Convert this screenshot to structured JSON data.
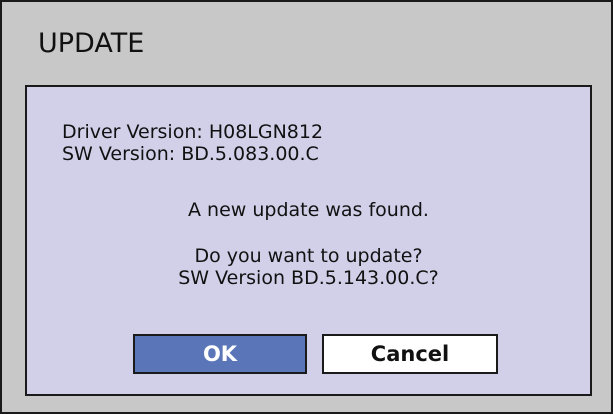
{
  "dialog": {
    "title": "UPDATE",
    "driver_version": "Driver Version:  H08LGN812",
    "sw_version": "SW Version:  BD.5.083.00.C",
    "message_found": "A new update was found.",
    "question_line1": "Do you want to update?",
    "question_line2": "SW Version  BD.5.143.00.C?",
    "ok_label": "OK",
    "cancel_label": "Cancel"
  },
  "colors": {
    "frame_background": "#c8c8c8",
    "panel_background": "#d2cfe9",
    "ok_button": "#5a76b8",
    "cancel_button": "#ffffff",
    "border": "#1a1a1a"
  }
}
